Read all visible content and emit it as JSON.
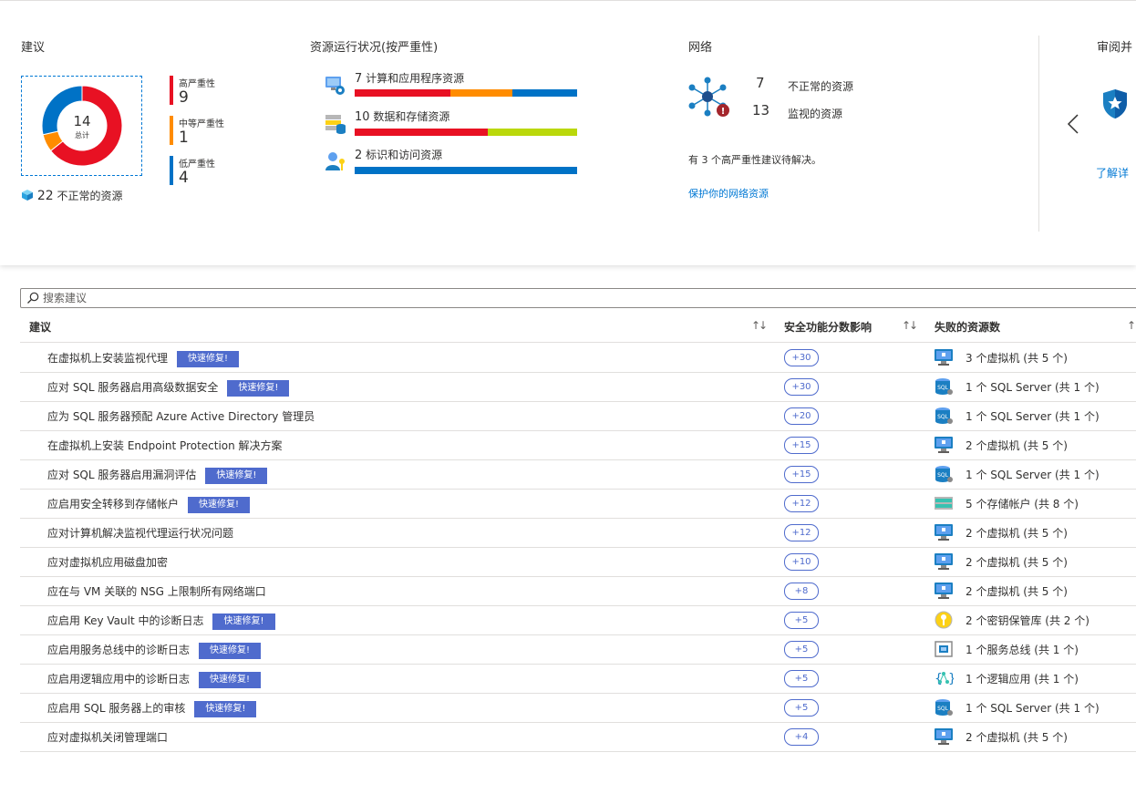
{
  "recommendations_card": {
    "title": "建议",
    "donut": {
      "total": "14",
      "total_label": "总计",
      "high": 9,
      "medium": 1,
      "low": 4
    },
    "severity": [
      {
        "label": "高严重性",
        "count": "9",
        "color": "#e81123"
      },
      {
        "label": "中等严重性",
        "count": "1",
        "color": "#ff8c00"
      },
      {
        "label": "低严重性",
        "count": "4",
        "color": "#0072c6"
      }
    ],
    "unhealthy_count": "22",
    "unhealthy_label": "不正常的资源"
  },
  "resource_health": {
    "title": "资源运行状况(按严重性)",
    "items": [
      {
        "count": "7",
        "label": "计算和应用程序资源",
        "icon": "compute-icon",
        "segments": [
          {
            "fraction": 0.43,
            "color": "#e81123"
          },
          {
            "fraction": 0.28,
            "color": "#ff8c00"
          },
          {
            "fraction": 0.29,
            "color": "#0072c6"
          }
        ]
      },
      {
        "count": "10",
        "label": "数据和存储资源",
        "icon": "data-storage-icon",
        "segments": [
          {
            "fraction": 0.6,
            "color": "#e81123"
          },
          {
            "fraction": 0.4,
            "color": "#bad80a"
          }
        ]
      },
      {
        "count": "2",
        "label": "标识和访问资源",
        "icon": "identity-icon",
        "segments": [
          {
            "fraction": 1.0,
            "color": "#0072c6"
          }
        ]
      }
    ]
  },
  "network": {
    "title": "网络",
    "unhealthy_count": "7",
    "unhealthy_label": "不正常的资源",
    "monitored_count": "13",
    "monitored_label": "监视的资源",
    "summary": "有 3 个高严重性建议待解决。",
    "link": "保护你的网络资源"
  },
  "review": {
    "title": "审阅并",
    "link": "了解详",
    "prev_icon": "chevron-left-icon",
    "badge_icon": "shield-star-icon"
  },
  "search": {
    "placeholder": "搜索建议"
  },
  "table": {
    "headers": {
      "recommendation": "建议",
      "secure_score_impact": "安全功能分数影响",
      "failed_resources": "失败的资源数"
    },
    "quick_fix_label": "快速修复!",
    "rows": [
      {
        "name": "在虚拟机上安装监视代理",
        "quick_fix": true,
        "impact": "+30",
        "icon": "vm",
        "resources": "3 个虚拟机 (共 5 个)"
      },
      {
        "name": "应对 SQL 服务器启用高级数据安全",
        "quick_fix": true,
        "impact": "+30",
        "icon": "sql",
        "resources": "1 个 SQL Server (共 1 个)"
      },
      {
        "name": "应为 SQL 服务器预配 Azure Active Directory 管理员",
        "quick_fix": false,
        "impact": "+20",
        "icon": "sql",
        "resources": "1 个 SQL Server (共 1 个)"
      },
      {
        "name": "在虚拟机上安装 Endpoint Protection 解决方案",
        "quick_fix": false,
        "impact": "+15",
        "icon": "vm",
        "resources": "2 个虚拟机 (共 5 个)"
      },
      {
        "name": "应对 SQL 服务器启用漏洞评估",
        "quick_fix": true,
        "impact": "+15",
        "icon": "sql",
        "resources": "1 个 SQL Server (共 1 个)"
      },
      {
        "name": "应启用安全转移到存储帐户",
        "quick_fix": true,
        "impact": "+12",
        "icon": "storage",
        "resources": "5 个存储帐户 (共 8 个)"
      },
      {
        "name": "应对计算机解决监视代理运行状况问题",
        "quick_fix": false,
        "impact": "+12",
        "icon": "vm",
        "resources": "2 个虚拟机 (共 5 个)"
      },
      {
        "name": "应对虚拟机应用磁盘加密",
        "quick_fix": false,
        "impact": "+10",
        "icon": "vm",
        "resources": "2 个虚拟机 (共 5 个)"
      },
      {
        "name": "应在与 VM 关联的 NSG 上限制所有网络端口",
        "quick_fix": false,
        "impact": "+8",
        "icon": "vm",
        "resources": "2 个虚拟机 (共 5 个)"
      },
      {
        "name": "应启用 Key Vault 中的诊断日志",
        "quick_fix": true,
        "impact": "+5",
        "icon": "keyvault",
        "resources": "2 个密钥保管库 (共 2 个)"
      },
      {
        "name": "应启用服务总线中的诊断日志",
        "quick_fix": true,
        "impact": "+5",
        "icon": "servicebus",
        "resources": "1 个服务总线 (共 1 个)"
      },
      {
        "name": "应启用逻辑应用中的诊断日志",
        "quick_fix": true,
        "impact": "+5",
        "icon": "logicapp",
        "resources": "1 个逻辑应用 (共 1 个)"
      },
      {
        "name": "应启用 SQL 服务器上的审核",
        "quick_fix": true,
        "impact": "+5",
        "icon": "sql",
        "resources": "1 个 SQL Server (共 1 个)"
      },
      {
        "name": "应对虚拟机关闭管理端口",
        "quick_fix": false,
        "impact": "+4",
        "icon": "vm",
        "resources": "2 个虚拟机 (共 5 个)"
      }
    ]
  }
}
